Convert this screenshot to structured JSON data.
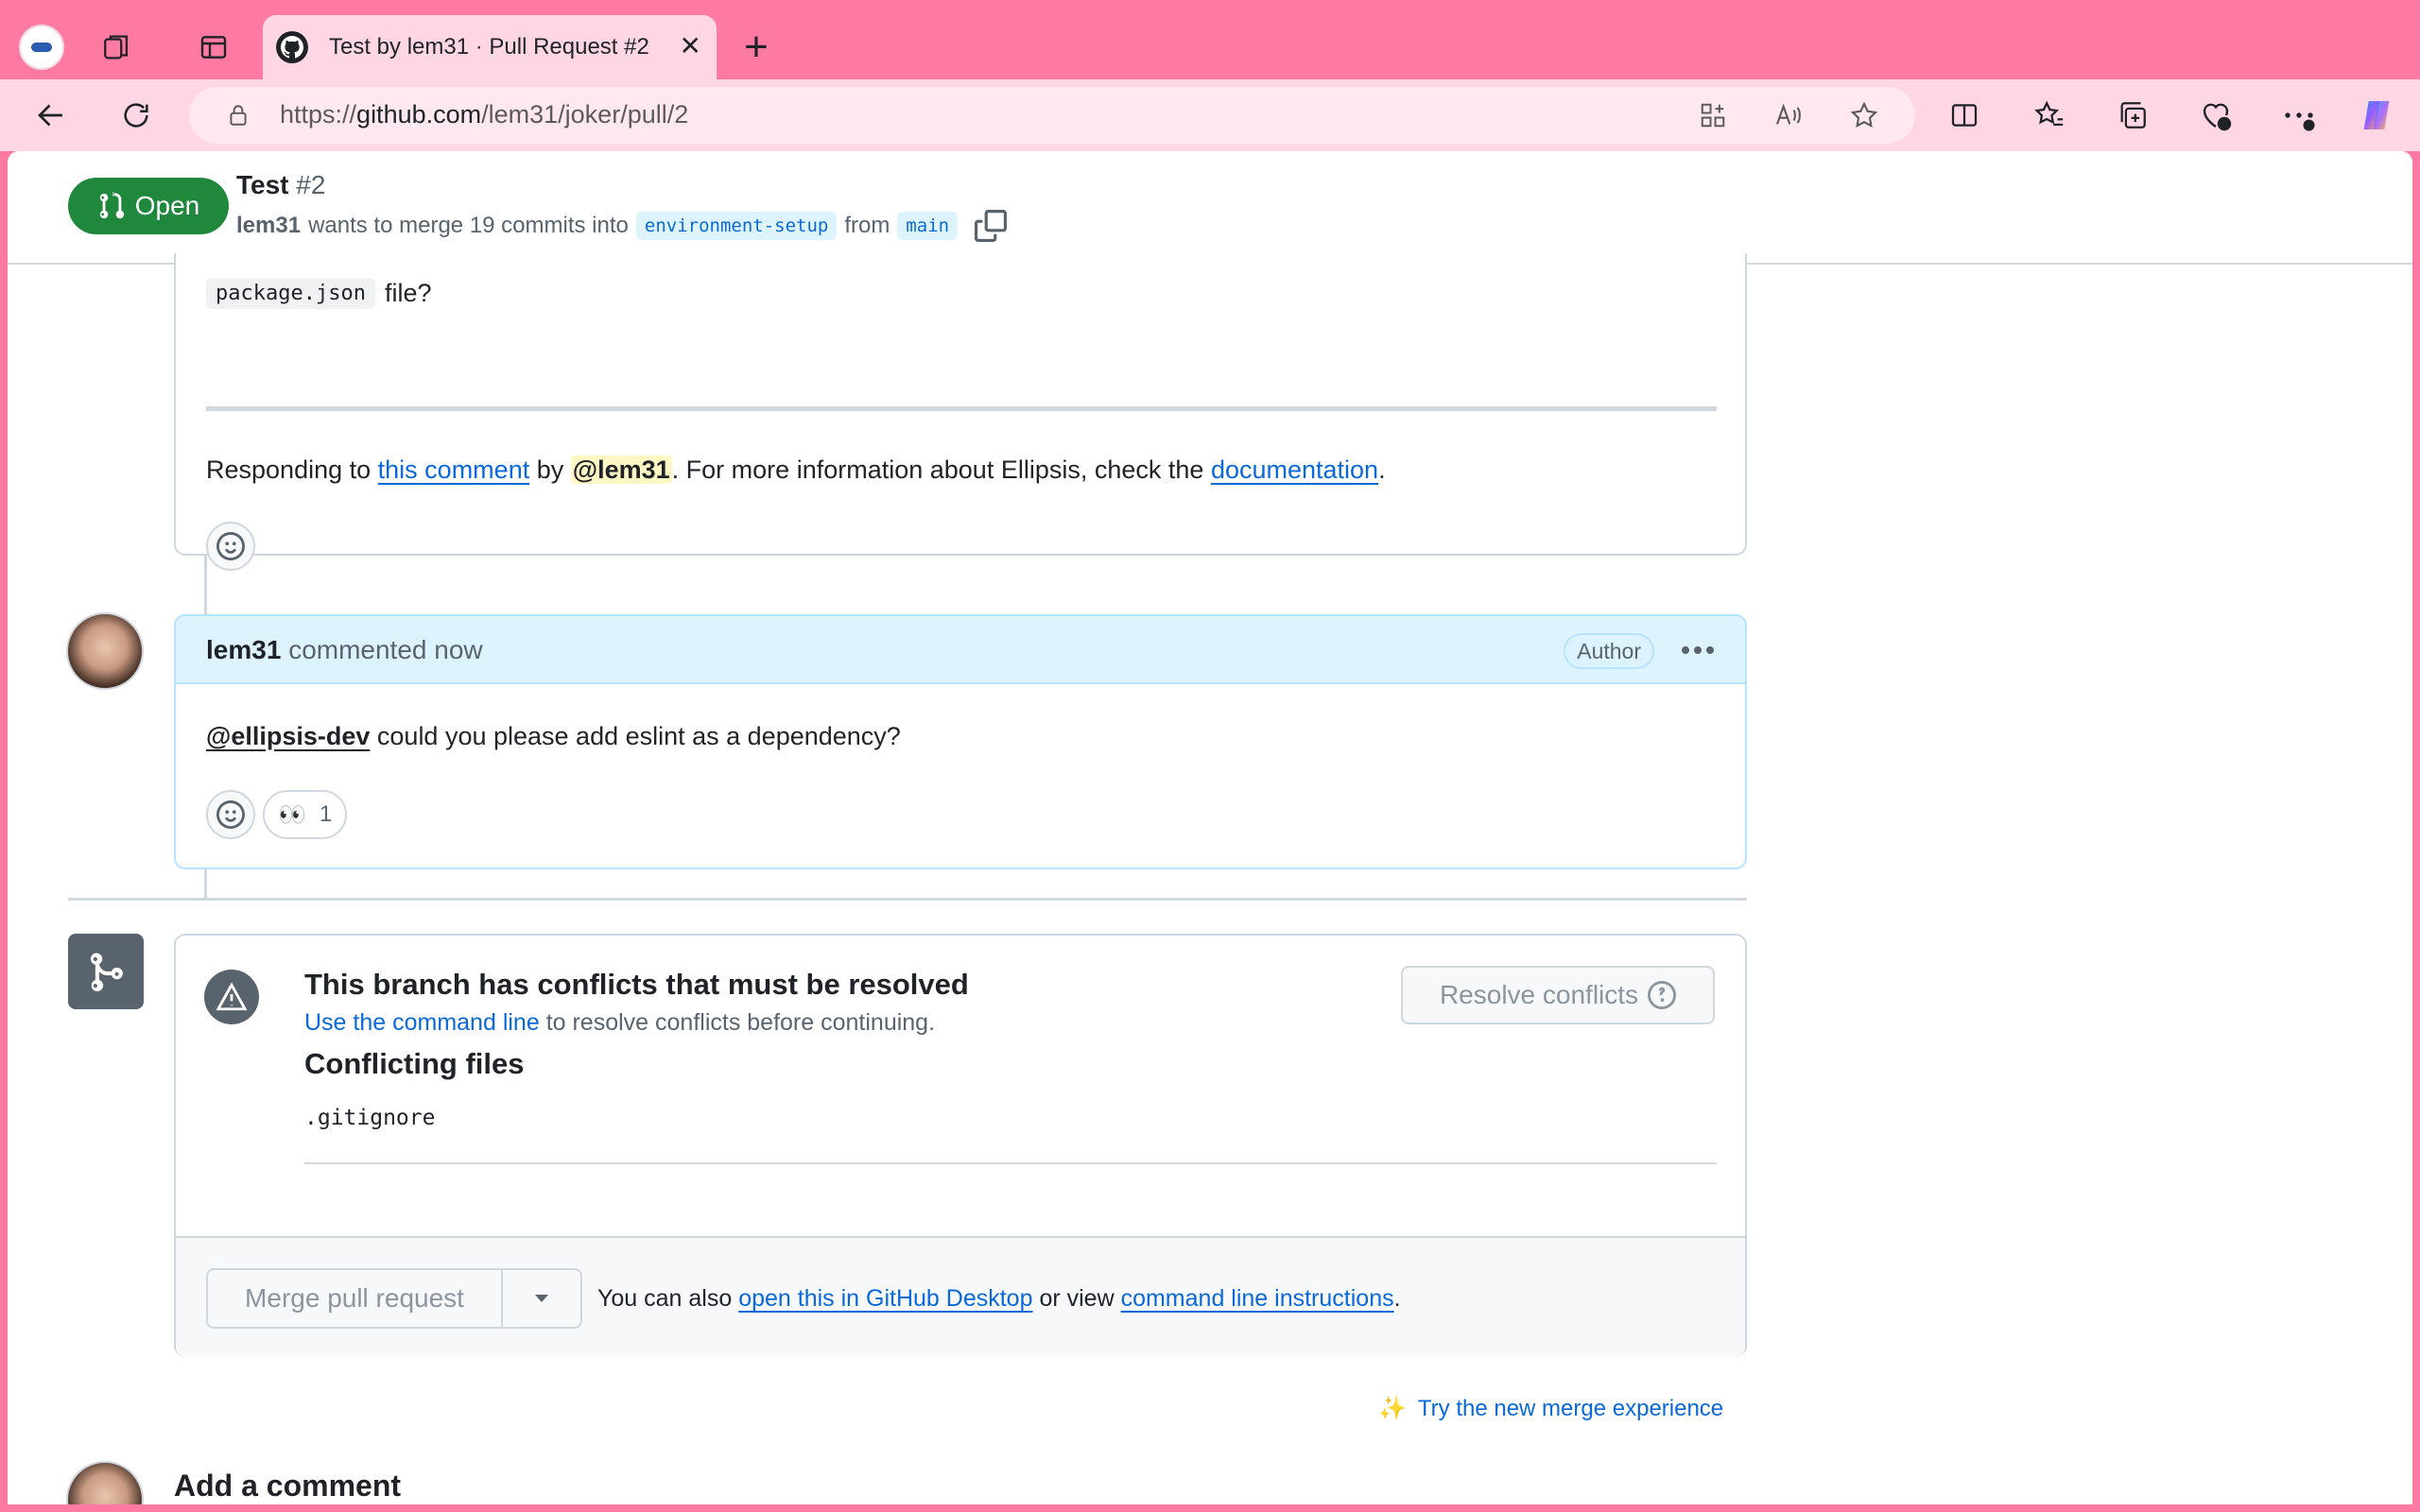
{
  "browser": {
    "tab_title": "Test by lem31 · Pull Request #2",
    "url_prefix": "https://",
    "url_host": "github.com",
    "url_path": "/lem31/joker/pull/2"
  },
  "pr": {
    "state": "Open",
    "title": "Test",
    "number": "#2",
    "author": "lem31",
    "merge_text": "wants to merge 19 commits into",
    "base_branch": "environment-setup",
    "from_text": "from",
    "head_branch": "main"
  },
  "bot_comment": {
    "code": "package.json",
    "code_suffix": "file?",
    "responding_prefix": "Responding to",
    "this_comment": "this comment",
    "by_text": "by",
    "mention": "@lem31",
    "info_text": ". For more information about Ellipsis, check the",
    "documentation": "documentation",
    "period": "."
  },
  "author_comment": {
    "author": "lem31",
    "meta": "commented now",
    "badge": "Author",
    "mention": "@ellipsis-dev",
    "body": "could you please add eslint as a dependency?",
    "reaction_emoji": "👀",
    "reaction_count": "1"
  },
  "merge_box": {
    "heading": "This branch has conflicts that must be resolved",
    "cmd_link": "Use the command line",
    "cmd_text": "to resolve conflicts before continuing.",
    "resolve_button": "Resolve conflicts",
    "conflicting_title": "Conflicting files",
    "files": [
      ".gitignore"
    ],
    "merge_button": "Merge pull request",
    "also_text": "You can also",
    "desktop_link": "open this in GitHub Desktop",
    "or_view": "or view",
    "cli_link": "command line instructions",
    "period": "."
  },
  "try_merge": {
    "emoji": "✨",
    "label": "Try the new merge experience"
  },
  "add_comment": {
    "heading": "Add a comment"
  }
}
